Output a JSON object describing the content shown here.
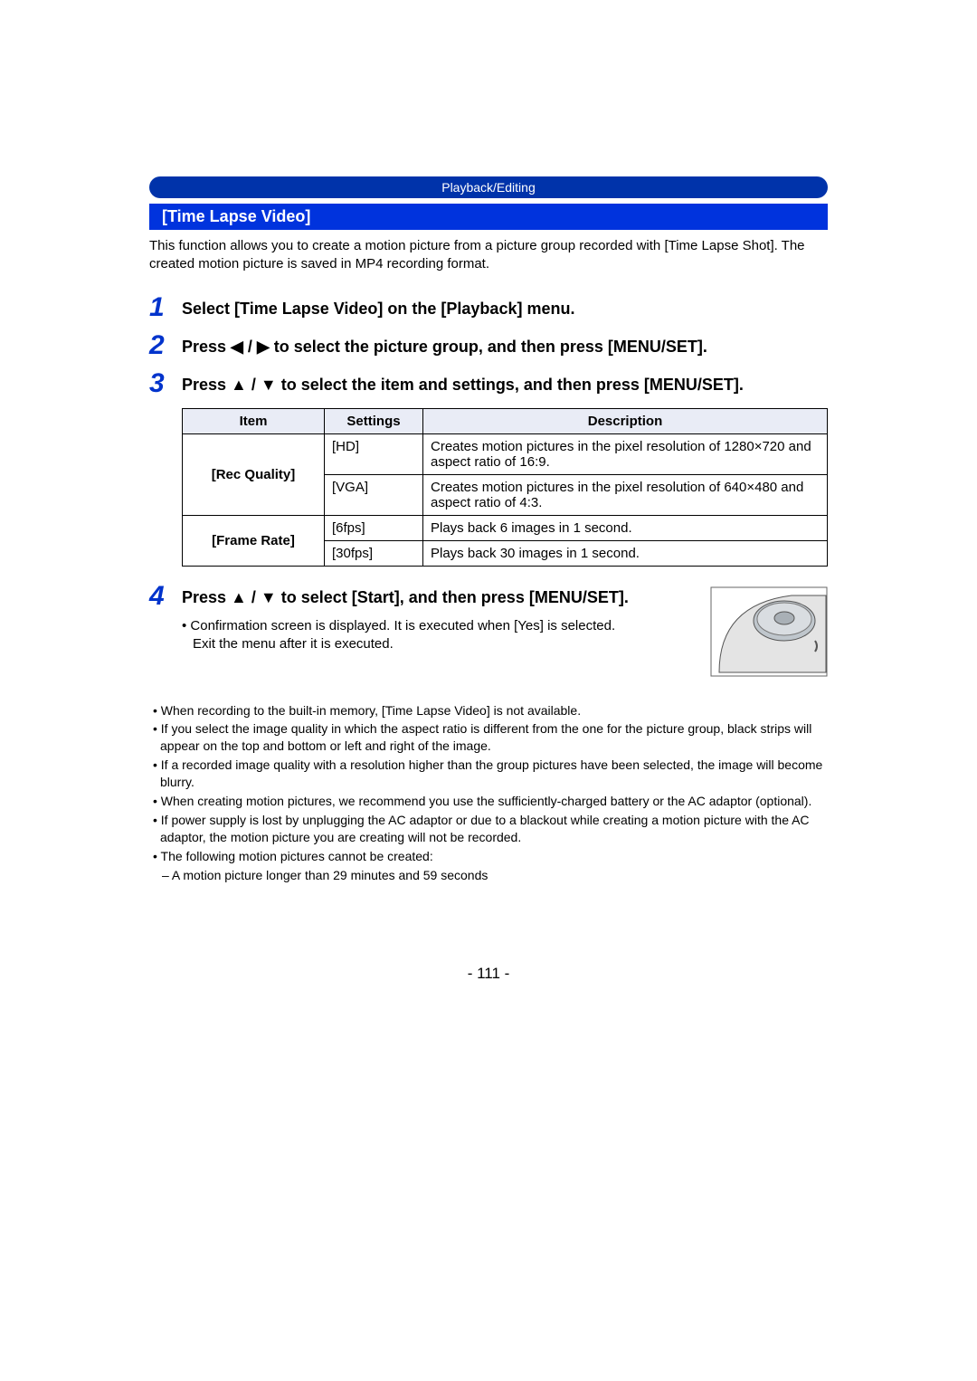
{
  "breadcrumb": "Playback/Editing",
  "section_title": "[Time Lapse Video]",
  "intro": "This function allows you to create a motion picture from a picture group recorded with [Time Lapse Shot]. The created motion picture is saved in MP4 recording format.",
  "steps": {
    "s1": {
      "num": "1",
      "text": "Select [Time Lapse Video] on the [Playback] menu."
    },
    "s2": {
      "num": "2",
      "pre": "Press ",
      "mid": " to select the picture group, and then press [MENU/SET].",
      "slash": "/"
    },
    "s3": {
      "num": "3",
      "pre": "Press ",
      "mid": " to select the item and settings, and then press [MENU/SET].",
      "slash": "/"
    },
    "s4": {
      "num": "4",
      "pre": "Press ",
      "mid": " to select [Start], and then press [MENU/SET].",
      "slash": "/"
    }
  },
  "table": {
    "headers": {
      "item": "Item",
      "settings": "Settings",
      "description": "Description"
    },
    "rows": [
      {
        "item": "[Rec Quality]",
        "setting": "[HD]",
        "desc": "Creates motion pictures in the pixel resolution of 1280×720 and aspect ratio of 16:9."
      },
      {
        "item": "",
        "setting": "[VGA]",
        "desc": "Creates motion pictures in the pixel resolution of 640×480 and aspect ratio of 4:3."
      },
      {
        "item": "[Frame Rate]",
        "setting": "[6fps]",
        "desc": "Plays back 6 images in 1 second."
      },
      {
        "item": "",
        "setting": "[30fps]",
        "desc": "Plays back 30 images in 1 second."
      }
    ]
  },
  "step4_sub": [
    "• Confirmation screen is displayed. It is executed when [Yes] is selected.",
    "Exit the menu after it is executed."
  ],
  "notes": [
    "• When recording to the built-in memory, [Time Lapse Video] is not available.",
    "• If you select the image quality in which the aspect ratio is different from the one for the picture group, black strips will appear on the top and bottom or left and right of the image.",
    "• If a recorded image quality with a resolution higher than the group pictures have been selected, the image will become blurry.",
    "• When creating motion pictures, we recommend you use the sufficiently-charged battery or the AC adaptor (optional).",
    "• If power supply is lost by unplugging the AC adaptor or due to a blackout while creating a motion picture with the AC adaptor, the motion picture you are creating will not be recorded.",
    "• The following motion pictures cannot be created:"
  ],
  "notes_sub": "– A motion picture longer than 29 minutes and 59 seconds",
  "page_number": "- 111 -",
  "glyphs": {
    "left_tri": "◀",
    "right_tri": "▶",
    "up_tri": "▲",
    "down_tri": "▼"
  }
}
